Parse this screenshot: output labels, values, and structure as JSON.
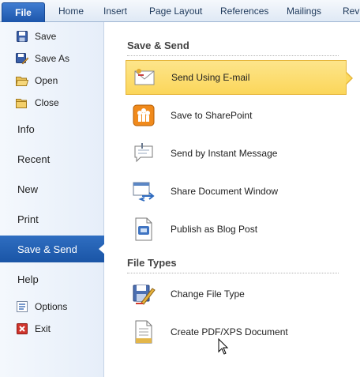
{
  "ribbon": {
    "file_label": "File",
    "tabs": [
      "Home",
      "Insert",
      "Page Layout",
      "References",
      "Mailings",
      "Revi"
    ]
  },
  "nav": {
    "commands": [
      {
        "label": "Save",
        "icon": "save-icon"
      },
      {
        "label": "Save As",
        "icon": "save-as-icon"
      },
      {
        "label": "Open",
        "icon": "open-folder-icon"
      },
      {
        "label": "Close",
        "icon": "close-folder-icon"
      }
    ],
    "items": [
      {
        "label": "Info"
      },
      {
        "label": "Recent"
      },
      {
        "label": "New"
      },
      {
        "label": "Print"
      },
      {
        "label": "Save & Send",
        "selected": true
      },
      {
        "label": "Help"
      }
    ],
    "bottom": [
      {
        "label": "Options",
        "icon": "options-icon"
      },
      {
        "label": "Exit",
        "icon": "exit-icon"
      }
    ]
  },
  "main": {
    "save_send": {
      "title": "Save & Send",
      "options": [
        {
          "label": "Send Using E-mail",
          "icon": "email-icon",
          "selected": true
        },
        {
          "label": "Save to SharePoint",
          "icon": "sharepoint-icon"
        },
        {
          "label": "Send by Instant Message",
          "icon": "instant-message-icon"
        },
        {
          "label": "Share Document Window",
          "icon": "share-window-icon"
        },
        {
          "label": "Publish as Blog Post",
          "icon": "blog-post-icon"
        }
      ]
    },
    "file_types": {
      "title": "File Types",
      "options": [
        {
          "label": "Change File Type",
          "icon": "change-file-type-icon"
        },
        {
          "label": "Create PDF/XPS Document",
          "icon": "pdf-xps-icon"
        }
      ]
    }
  },
  "colors": {
    "file_tab": "#2a64b8",
    "nav_selected": "#2563b4",
    "option_selected": "#fcdc70"
  }
}
